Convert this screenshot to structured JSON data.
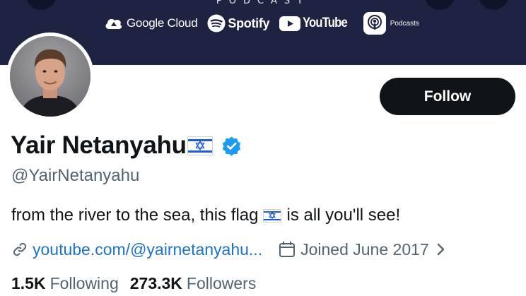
{
  "banner": {
    "podcast_word": "PODCAST",
    "logos": [
      {
        "icon": "google-cloud-icon",
        "label": "Google Cloud"
      },
      {
        "icon": "spotify-icon",
        "label": "Spotify"
      },
      {
        "icon": "youtube-icon",
        "label": "YouTube"
      },
      {
        "icon": "apple-podcasts-icon",
        "label": "Podcasts"
      }
    ]
  },
  "profile": {
    "display_name": "Yair Netanyahu",
    "handle": "@YairNetanyahu",
    "verified_color": "#1d9bf0",
    "bio_before_flag": "from the river to the sea, this flag",
    "bio_after_flag": "is all you'll see!",
    "website": "youtube.com/@yairnetanyahu...",
    "joined": "Joined June 2017"
  },
  "actions": {
    "follow_label": "Follow"
  },
  "stats": {
    "following_count": "1.5K",
    "following_label": "Following",
    "followers_count": "273.3K",
    "followers_label": "Followers"
  },
  "colors": {
    "banner_bg": "#1d2340",
    "link": "#1d72c8",
    "secondary_text": "#536471",
    "flag_blue": "#1f5bd8"
  }
}
